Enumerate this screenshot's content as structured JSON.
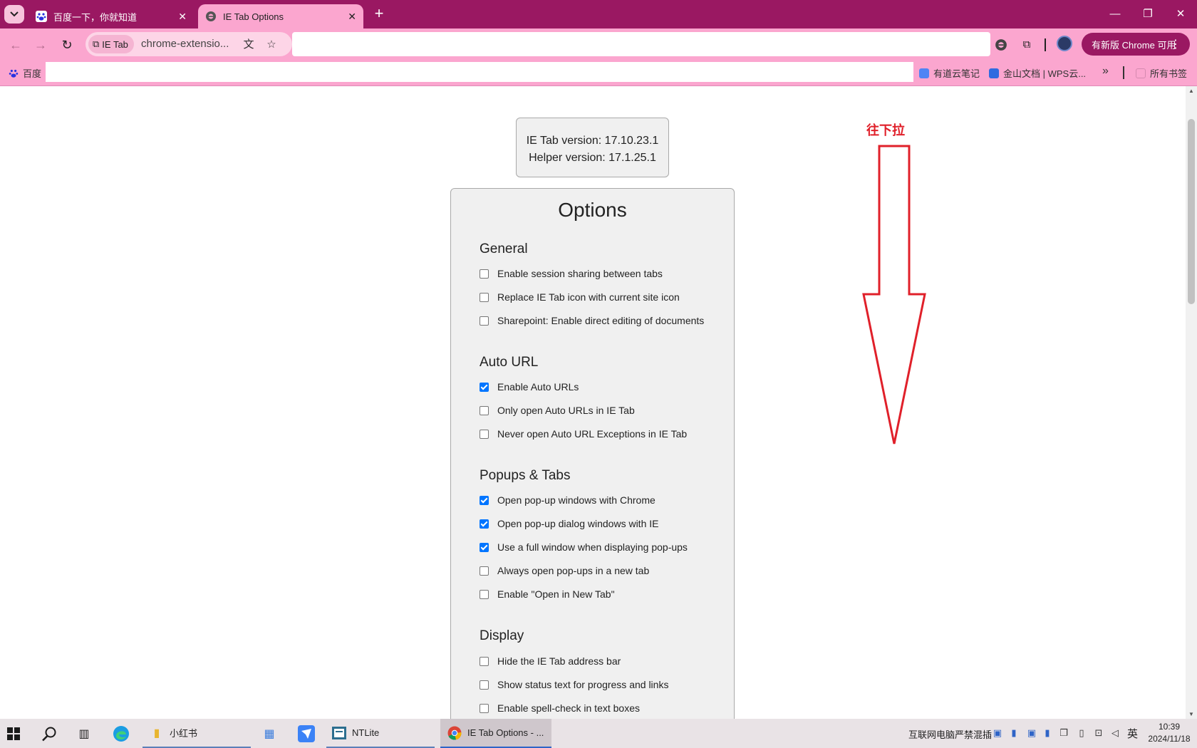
{
  "tabs": [
    {
      "title": "百度一下，你就知道",
      "favicon": "baidu-paw-icon"
    },
    {
      "title": "IE Tab Options",
      "favicon": "ie-tab-icon"
    }
  ],
  "toolbar": {
    "site_chip": "IE Tab",
    "url": "chrome-extensio...",
    "update_button": "有新版 Chrome 可用"
  },
  "bookmarks": {
    "items": [
      {
        "label": "百度",
        "icon": "baidu-paw-icon"
      },
      {
        "label": "有道云笔记",
        "icon": "youdao-note-icon"
      },
      {
        "label": "金山文档 | WPS云...",
        "icon": "kingsoft-docs-icon"
      }
    ],
    "overflow": "»",
    "all_bookmarks": "所有书签"
  },
  "version_box": {
    "ie_tab_version": "IE Tab version: 17.10.23.1",
    "helper_version": "Helper version: 17.1.25.1"
  },
  "options": {
    "title": "Options",
    "sections": [
      {
        "title": "General",
        "items": [
          {
            "label": "Enable session sharing between tabs",
            "checked": false
          },
          {
            "label": "Replace IE Tab icon with current site icon",
            "checked": false
          },
          {
            "label": "Sharepoint: Enable direct editing of documents",
            "checked": false
          }
        ]
      },
      {
        "title": "Auto URL",
        "items": [
          {
            "label": "Enable Auto URLs",
            "checked": true
          },
          {
            "label": "Only open Auto URLs in IE Tab",
            "checked": false
          },
          {
            "label": "Never open Auto URL Exceptions in IE Tab",
            "checked": false
          }
        ]
      },
      {
        "title": "Popups & Tabs",
        "items": [
          {
            "label": "Open pop-up windows with Chrome",
            "checked": true
          },
          {
            "label": "Open pop-up dialog windows with IE",
            "checked": true
          },
          {
            "label": "Use a full window when displaying pop-ups",
            "checked": true
          },
          {
            "label": "Always open pop-ups in a new tab",
            "checked": false
          },
          {
            "label": "Enable \"Open in New Tab\"",
            "checked": false
          }
        ]
      },
      {
        "title": "Display",
        "items": [
          {
            "label": "Hide the IE Tab address bar",
            "checked": false
          },
          {
            "label": "Show status text for progress and links",
            "checked": false
          },
          {
            "label": "Enable spell-check in text boxes",
            "checked": false
          }
        ]
      }
    ]
  },
  "annotation": {
    "text": "往下拉",
    "color": "#e0202a"
  },
  "taskbar": {
    "apps": [
      {
        "label": "小红书",
        "icon": "folder-icon"
      },
      {
        "label": "NTLite",
        "icon": "ntlite-icon"
      },
      {
        "label": "IE Tab Options - ...",
        "icon": "chrome-icon"
      }
    ],
    "tray_text": "互联网电脑严禁混插",
    "ime": "英",
    "time": "10:39",
    "date": "2024/11/18"
  },
  "colors": {
    "tabstrip": "#9a1862",
    "toolbar": "#fba6cf",
    "checkbox_accent": "#0075ff"
  }
}
